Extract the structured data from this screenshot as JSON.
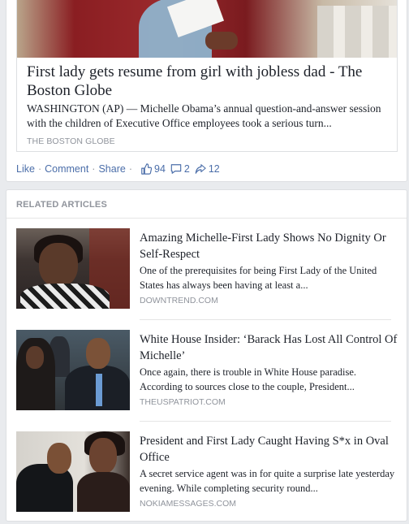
{
  "post": {
    "link": {
      "title": "First lady gets resume from girl with jobless dad - The Boston Globe",
      "description": "WASHINGTON (AP) — Michelle Obama’s annual question-and-answer session with the children of Executive Office employees took a serious turn...",
      "source": "THE BOSTON GLOBE"
    },
    "actions": {
      "like": "Like",
      "comment": "Comment",
      "share": "Share",
      "sep": "·",
      "likes_count": "94",
      "comments_count": "2",
      "shares_count": "12"
    }
  },
  "related": {
    "header": "RELATED ARTICLES",
    "items": [
      {
        "title": "Amazing Michelle-First Lady Shows No Dignity Or Self-Respect",
        "description": "One of the prerequisites for being First Lady of the United States has always been having at least a...",
        "source": "DOWNTREND.COM"
      },
      {
        "title": "White House Insider: ‘Barack Has Lost All Control Of Michelle’",
        "description": "Once again, there is trouble in White House paradise. According to sources close to the couple, President...",
        "source": "THEUSPATRIOT.COM"
      },
      {
        "title": "President and First Lady Caught Having S*x in Oval Office",
        "description": "A secret service agent was in for quite a surprise late yesterday evening. While completing security round...",
        "source": "NOKIAMESSAGES.COM"
      }
    ]
  },
  "colors": {
    "link_blue": "#4b6ea9",
    "muted_gray": "#90949c",
    "text": "#1d2129",
    "page_bg": "#e9ebee"
  },
  "icons": {
    "likes": "thumbs-up-icon",
    "comments": "comment-bubble-icon",
    "shares": "share-arrow-icon"
  }
}
